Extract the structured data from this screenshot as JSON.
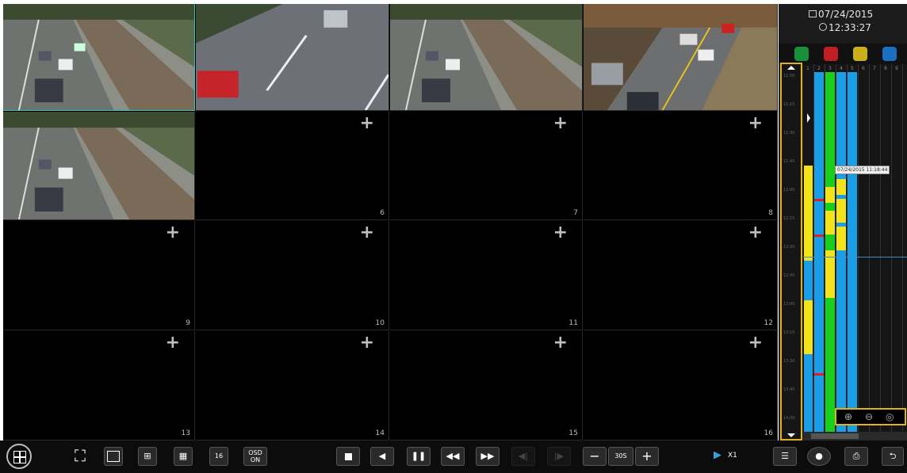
{
  "side_panel": {
    "date": "07/24/2015",
    "time": "12:33:27",
    "tooltip": "07/24/2015 11:18:44",
    "channel_numbers": [
      "1",
      "2",
      "3",
      "4",
      "5",
      "6",
      "7",
      "8",
      "9"
    ],
    "time_labels": [
      "11:00",
      "11:15",
      "11:30",
      "11:45",
      "12:00",
      "12:15",
      "12:30",
      "12:45",
      "13:00",
      "13:15",
      "13:30",
      "13:45",
      "14:00"
    ]
  },
  "tiles": {
    "numbers": [
      "6",
      "7",
      "8",
      "9",
      "10",
      "11",
      "12",
      "13",
      "14",
      "15",
      "16"
    ]
  },
  "toolbar": {
    "osd_line1": "OSD",
    "osd_line2": "ON",
    "skip_label": "30S",
    "speed_label": "X1"
  },
  "colors": {
    "accent": "#e0b21a",
    "active_border": "#36c0b8",
    "track_blue": "#1b9ee8",
    "track_green": "#18d01b",
    "track_yellow": "#f4e21a",
    "track_red": "#e02020"
  },
  "icons": [
    "menu-icon",
    "fullscreen-icon",
    "layout-1-icon",
    "layout-4-icon",
    "layout-9-icon",
    "layout-16-icon",
    "stop-icon",
    "step-back-icon",
    "pause-icon",
    "rewind-icon",
    "fast-forward-icon",
    "prev-frame-icon",
    "next-frame-icon",
    "minus-icon",
    "plus-icon",
    "speed-play-icon",
    "list-icon",
    "backup-icon",
    "snapshot-icon",
    "return-icon"
  ]
}
